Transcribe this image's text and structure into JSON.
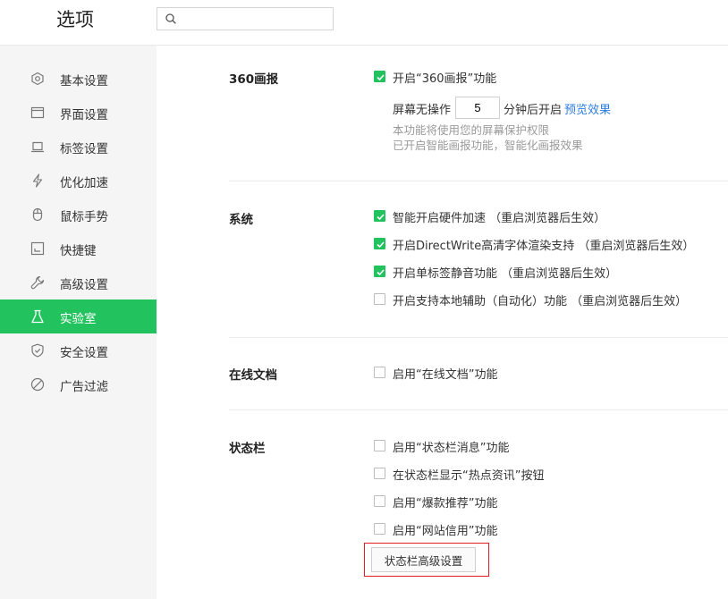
{
  "header": {
    "title": "选项",
    "search": {
      "value": "",
      "placeholder": ""
    }
  },
  "sidebar": {
    "items": [
      {
        "label": "基本设置",
        "icon": "hexagon-gear-icon"
      },
      {
        "label": "界面设置",
        "icon": "window-icon"
      },
      {
        "label": "标签设置",
        "icon": "tab-icon"
      },
      {
        "label": "优化加速",
        "icon": "lightning-icon"
      },
      {
        "label": "鼠标手势",
        "icon": "mouse-icon"
      },
      {
        "label": "快捷键",
        "icon": "keyboard-icon"
      },
      {
        "label": "高级设置",
        "icon": "wrench-icon"
      },
      {
        "label": "实验室",
        "icon": "flask-icon",
        "active": true
      },
      {
        "label": "安全设置",
        "icon": "shield-icon"
      },
      {
        "label": "广告过滤",
        "icon": "block-icon"
      }
    ],
    "active_color": "#22c35e"
  },
  "sections": {
    "screensaver": {
      "title": "360画报",
      "enable": {
        "label": "开启“360画报”功能",
        "checked": true
      },
      "delay": {
        "prefix": "屏幕无操作",
        "value": "5",
        "suffix": "分钟后开启",
        "preview_link": "预览效果"
      },
      "notes": [
        "本功能将使用您的屏幕保护权限",
        "已开启智能画报功能，智能化画报效果"
      ]
    },
    "system": {
      "title": "系统",
      "options": [
        {
          "label": "智能开启硬件加速 （重启浏览器后生效）",
          "checked": true
        },
        {
          "label": "开启DirectWrite高清字体渲染支持 （重启浏览器后生效）",
          "checked": true
        },
        {
          "label": "开启单标签静音功能 （重启浏览器后生效）",
          "checked": true
        },
        {
          "label": "开启支持本地辅助（自动化）功能 （重启浏览器后生效）",
          "checked": false
        }
      ]
    },
    "online_docs": {
      "title": "在线文档",
      "options": [
        {
          "label": "启用“在线文档”功能",
          "checked": false
        }
      ]
    },
    "statusbar": {
      "title": "状态栏",
      "options": [
        {
          "label": "启用“状态栏消息”功能",
          "checked": false
        },
        {
          "label": "在状态栏显示“热点资讯”按钮",
          "checked": false
        },
        {
          "label": "启用“爆款推荐”功能",
          "checked": false
        },
        {
          "label": "启用“网站信用”功能",
          "checked": false
        }
      ],
      "advanced_button": "状态栏高级设置"
    }
  },
  "colors": {
    "accent": "#22c35e",
    "link": "#2d7de0",
    "highlight_border": "#e02020"
  }
}
